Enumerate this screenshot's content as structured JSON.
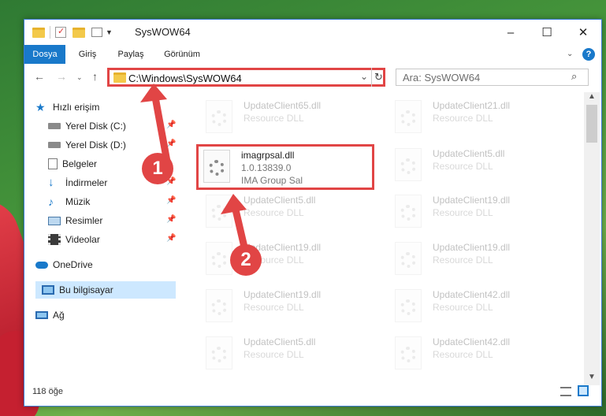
{
  "window": {
    "title": "SysWOW64"
  },
  "ribbon": {
    "tabs": [
      "Dosya",
      "Giriş",
      "Paylaş",
      "Görünüm"
    ],
    "help": "?"
  },
  "address": {
    "path": "C:\\Windows\\SysWOW64"
  },
  "search": {
    "placeholder": "Ara: SysWOW64"
  },
  "sidebar": {
    "quick_access": "Hızlı erişim",
    "items": [
      "Yerel Disk (C:)",
      "Yerel Disk (D:)",
      "Belgeler",
      "İndirmeler",
      "Müzik",
      "Resimler",
      "Videolar"
    ],
    "onedrive": "OneDrive",
    "this_pc": "Bu bilgisayar",
    "network": "Ağ"
  },
  "files": {
    "highlighted": {
      "name": "imagrpsal.dll",
      "version": "1.0.13839.0",
      "company": "IMA Group Sal"
    },
    "faded": [
      {
        "name": "UpdateClient65.dll",
        "sub": "Resource DLL"
      },
      {
        "name": "UpdateClient21.dll",
        "sub": "Resource DLL"
      },
      {
        "name": "UpdateClient5.dll",
        "sub": "Resource DLL"
      },
      {
        "name": "UpdateClient5.dll",
        "sub": "Resource DLL"
      },
      {
        "name": "UpdateClient19.dll",
        "sub": "Resource DLL"
      },
      {
        "name": "UpdateClient19.dll",
        "sub": "Resource DLL"
      },
      {
        "name": "UpdateClient19.dll",
        "sub": "Resource DLL"
      },
      {
        "name": "UpdateClient19.dll",
        "sub": "Resource DLL"
      },
      {
        "name": "UpdateClient42.dll",
        "sub": "Resource DLL"
      },
      {
        "name": "UpdateClient5.dll",
        "sub": "Resource DLL"
      },
      {
        "name": "UpdateClient42.dll",
        "sub": "Resource DLL"
      }
    ]
  },
  "status": {
    "count": "118 öğe"
  },
  "annotations": {
    "step1": "1",
    "step2": "2",
    "color": "#e14545"
  }
}
